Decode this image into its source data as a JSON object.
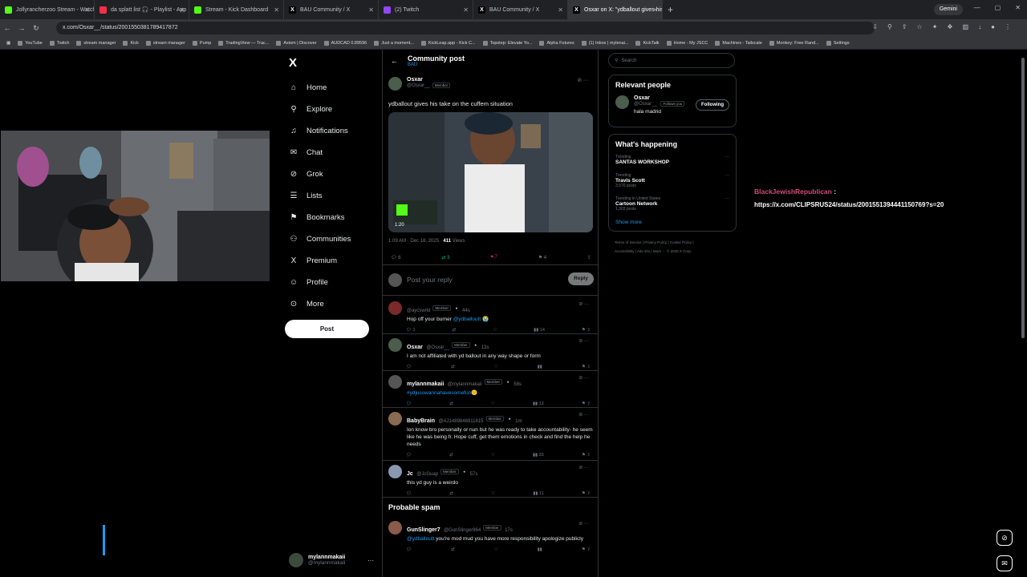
{
  "browser": {
    "tabs": [
      {
        "label": "Jollyrancherzoo Stream - Watch",
        "favicon": "kick",
        "active": false
      },
      {
        "label": "da splatt list 🎧 - Playlist - App",
        "favicon": "music",
        "active": false
      },
      {
        "label": "Stream - Kick Dashboard",
        "favicon": "kick",
        "active": false
      },
      {
        "label": "BAU Community / X",
        "favicon": "x",
        "active": false
      },
      {
        "label": "(2) Twitch",
        "favicon": "twitch",
        "active": false
      },
      {
        "label": "BAU Community / X",
        "favicon": "x",
        "active": false
      },
      {
        "label": "Osxar on X: \"ydballout gives his",
        "favicon": "x",
        "active": true
      }
    ],
    "new_tab": "+",
    "gemini_label": "Gemini",
    "url": "x.com/Osxar__/status/2001550381789417872",
    "bookmarks": [
      "YouTube",
      "Twitch",
      "stream manager",
      "Kick",
      "stream manager",
      "Pump",
      "TradingView — Trac...",
      "Axiom | Discover",
      "AUDCAD 0.89596",
      "Just a moment...",
      "KickLeap.app - Kick C...",
      "Topstep: Elevate Yo...",
      "Alpha Futures",
      "(1) Inbox | mylenai...",
      "KickTalk",
      "Home - My JSCC",
      "Machines - Tailscale",
      "Monkey: Free Rand...",
      "Settings"
    ]
  },
  "sidebar": {
    "logo": "X",
    "items": [
      {
        "label": "Home",
        "icon": "home-icon",
        "glyph": "⌂"
      },
      {
        "label": "Explore",
        "icon": "search-icon",
        "glyph": "⚲"
      },
      {
        "label": "Notifications",
        "icon": "bell-icon",
        "glyph": "♫"
      },
      {
        "label": "Chat",
        "icon": "chat-icon",
        "glyph": "✉"
      },
      {
        "label": "Grok",
        "icon": "grok-icon",
        "glyph": "⊘"
      },
      {
        "label": "Lists",
        "icon": "list-icon",
        "glyph": "☰"
      },
      {
        "label": "Bookmarks",
        "icon": "bookmark-icon",
        "glyph": "⚑"
      },
      {
        "label": "Communities",
        "icon": "communities-icon",
        "glyph": "⚇"
      },
      {
        "label": "Premium",
        "icon": "x-icon",
        "glyph": "X"
      },
      {
        "label": "Profile",
        "icon": "profile-icon",
        "glyph": "☺"
      },
      {
        "label": "More",
        "icon": "more-icon",
        "glyph": "⊙"
      }
    ],
    "post_button": "Post",
    "account": {
      "name": "mylannmakaii",
      "handle": "@mylannmakaii",
      "more": "···"
    }
  },
  "feed": {
    "header": {
      "title": "Community post",
      "subtitle": "BAU"
    },
    "op": {
      "name": "Osxar",
      "handle": "@Osxar__",
      "badge": "Member",
      "text": "ydballout gives his take on the cuffem situation",
      "video_time": "1:20",
      "time": "1:09 AM · Dec 18, 2025 · ",
      "views": "411",
      "views_label": " Views",
      "replies": "6",
      "reposts": "3",
      "likes": "7",
      "bookmarks": "4"
    },
    "reply_placeholder": "Post your reply",
    "reply_button": "Reply",
    "replies": [
      {
        "name": "",
        "handle": "@aycswrld",
        "badge": "Member",
        "time": "44s",
        "text": "Hop off your burner ",
        "mention": "@ydballoutt",
        "emoji": " 😭",
        "replies": "1",
        "views": "14"
      },
      {
        "name": "Osxar",
        "handle": "@Osxar__",
        "badge": "Member",
        "time": "13s",
        "text": "I am not affiliated with yd ballout in any way shape or form",
        "mention": "",
        "emoji": "",
        "replies": "",
        "views": ""
      },
      {
        "name": "mylannmakaii",
        "handle": "@mylannmakaii",
        "badge": "Member",
        "time": "58s",
        "text": "",
        "mention": "#ydjusswannahavesomefun",
        "emoji": "😕",
        "replies": "",
        "views": "13"
      },
      {
        "name": "BabyBrain",
        "handle": "@AJ1489846911815",
        "badge": "Member",
        "time": "1m",
        "text": "Ion know bro personally or nun but he was ready to take accountability- he seem like he was being fr. Hope cuff, get them emotions in check and find the help he needs",
        "mention": "",
        "emoji": "",
        "replies": "",
        "views": "33"
      },
      {
        "name": "Jc",
        "handle": "@JcGuap",
        "badge": "Member",
        "time": "57s",
        "text": "this yd guy is a weirdo",
        "mention": "",
        "emoji": "",
        "replies": "",
        "views": "11"
      }
    ],
    "spam_heading": "Probable spam",
    "spam": {
      "name": "GunSlinger7",
      "handle": "@GunSlinger964",
      "badge": "Member",
      "time": "17s",
      "mention": "@ydballoutt",
      "text": " you're mod mud you have more responsibility apologize publicly"
    }
  },
  "right": {
    "search_placeholder": "Search",
    "relevant": {
      "title": "Relevant people",
      "name": "Osxar",
      "handle": "@Osxar__",
      "follows": "Follows you",
      "button": "Following",
      "bio": "hala madrid"
    },
    "happening": {
      "title": "What's happening",
      "trends": [
        {
          "context": "Trending",
          "name": "SANTAS WORKSHOP",
          "posts": ""
        },
        {
          "context": "Trending",
          "name": "Travis Scott",
          "posts": "3,570 posts"
        },
        {
          "context": "Trending in United States",
          "name": "Cartoon Network",
          "posts": "1,303 posts"
        }
      ],
      "show_more": "Show more"
    },
    "footer": [
      "Terms of Service  |  Privacy Policy  |  Cookie Policy  |",
      "Accessibility  |  Ads info  |  More ···  © 2025 X Corp."
    ]
  },
  "overlay": {
    "user": "BlackJewishRepublican",
    "colon": " :",
    "link": "https://x.com/CLIPSRUS24/status/2001551394441150769?s=20"
  },
  "colors": {
    "accent": "#1d9bf0",
    "like": "#f91880",
    "repost": "#00ba7c",
    "overlay_user": "#d14b7a"
  }
}
